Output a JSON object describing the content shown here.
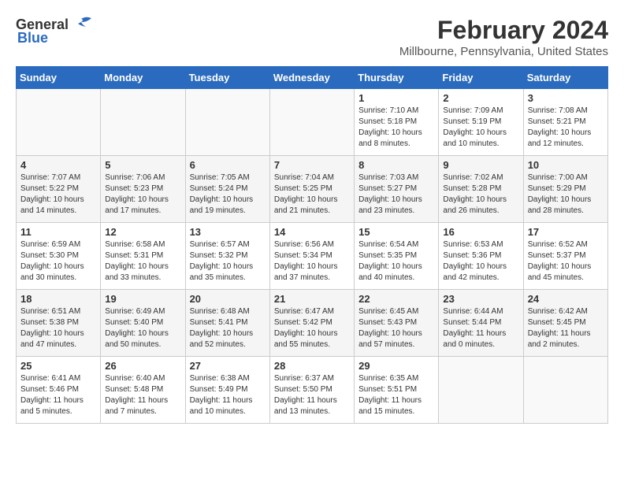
{
  "logo": {
    "general": "General",
    "blue": "Blue"
  },
  "title": "February 2024",
  "subtitle": "Millbourne, Pennsylvania, United States",
  "days_of_week": [
    "Sunday",
    "Monday",
    "Tuesday",
    "Wednesday",
    "Thursday",
    "Friday",
    "Saturday"
  ],
  "weeks": [
    [
      {
        "day": "",
        "info": ""
      },
      {
        "day": "",
        "info": ""
      },
      {
        "day": "",
        "info": ""
      },
      {
        "day": "",
        "info": ""
      },
      {
        "day": "1",
        "info": "Sunrise: 7:10 AM\nSunset: 5:18 PM\nDaylight: 10 hours\nand 8 minutes."
      },
      {
        "day": "2",
        "info": "Sunrise: 7:09 AM\nSunset: 5:19 PM\nDaylight: 10 hours\nand 10 minutes."
      },
      {
        "day": "3",
        "info": "Sunrise: 7:08 AM\nSunset: 5:21 PM\nDaylight: 10 hours\nand 12 minutes."
      }
    ],
    [
      {
        "day": "4",
        "info": "Sunrise: 7:07 AM\nSunset: 5:22 PM\nDaylight: 10 hours\nand 14 minutes."
      },
      {
        "day": "5",
        "info": "Sunrise: 7:06 AM\nSunset: 5:23 PM\nDaylight: 10 hours\nand 17 minutes."
      },
      {
        "day": "6",
        "info": "Sunrise: 7:05 AM\nSunset: 5:24 PM\nDaylight: 10 hours\nand 19 minutes."
      },
      {
        "day": "7",
        "info": "Sunrise: 7:04 AM\nSunset: 5:25 PM\nDaylight: 10 hours\nand 21 minutes."
      },
      {
        "day": "8",
        "info": "Sunrise: 7:03 AM\nSunset: 5:27 PM\nDaylight: 10 hours\nand 23 minutes."
      },
      {
        "day": "9",
        "info": "Sunrise: 7:02 AM\nSunset: 5:28 PM\nDaylight: 10 hours\nand 26 minutes."
      },
      {
        "day": "10",
        "info": "Sunrise: 7:00 AM\nSunset: 5:29 PM\nDaylight: 10 hours\nand 28 minutes."
      }
    ],
    [
      {
        "day": "11",
        "info": "Sunrise: 6:59 AM\nSunset: 5:30 PM\nDaylight: 10 hours\nand 30 minutes."
      },
      {
        "day": "12",
        "info": "Sunrise: 6:58 AM\nSunset: 5:31 PM\nDaylight: 10 hours\nand 33 minutes."
      },
      {
        "day": "13",
        "info": "Sunrise: 6:57 AM\nSunset: 5:32 PM\nDaylight: 10 hours\nand 35 minutes."
      },
      {
        "day": "14",
        "info": "Sunrise: 6:56 AM\nSunset: 5:34 PM\nDaylight: 10 hours\nand 37 minutes."
      },
      {
        "day": "15",
        "info": "Sunrise: 6:54 AM\nSunset: 5:35 PM\nDaylight: 10 hours\nand 40 minutes."
      },
      {
        "day": "16",
        "info": "Sunrise: 6:53 AM\nSunset: 5:36 PM\nDaylight: 10 hours\nand 42 minutes."
      },
      {
        "day": "17",
        "info": "Sunrise: 6:52 AM\nSunset: 5:37 PM\nDaylight: 10 hours\nand 45 minutes."
      }
    ],
    [
      {
        "day": "18",
        "info": "Sunrise: 6:51 AM\nSunset: 5:38 PM\nDaylight: 10 hours\nand 47 minutes."
      },
      {
        "day": "19",
        "info": "Sunrise: 6:49 AM\nSunset: 5:40 PM\nDaylight: 10 hours\nand 50 minutes."
      },
      {
        "day": "20",
        "info": "Sunrise: 6:48 AM\nSunset: 5:41 PM\nDaylight: 10 hours\nand 52 minutes."
      },
      {
        "day": "21",
        "info": "Sunrise: 6:47 AM\nSunset: 5:42 PM\nDaylight: 10 hours\nand 55 minutes."
      },
      {
        "day": "22",
        "info": "Sunrise: 6:45 AM\nSunset: 5:43 PM\nDaylight: 10 hours\nand 57 minutes."
      },
      {
        "day": "23",
        "info": "Sunrise: 6:44 AM\nSunset: 5:44 PM\nDaylight: 11 hours\nand 0 minutes."
      },
      {
        "day": "24",
        "info": "Sunrise: 6:42 AM\nSunset: 5:45 PM\nDaylight: 11 hours\nand 2 minutes."
      }
    ],
    [
      {
        "day": "25",
        "info": "Sunrise: 6:41 AM\nSunset: 5:46 PM\nDaylight: 11 hours\nand 5 minutes."
      },
      {
        "day": "26",
        "info": "Sunrise: 6:40 AM\nSunset: 5:48 PM\nDaylight: 11 hours\nand 7 minutes."
      },
      {
        "day": "27",
        "info": "Sunrise: 6:38 AM\nSunset: 5:49 PM\nDaylight: 11 hours\nand 10 minutes."
      },
      {
        "day": "28",
        "info": "Sunrise: 6:37 AM\nSunset: 5:50 PM\nDaylight: 11 hours\nand 13 minutes."
      },
      {
        "day": "29",
        "info": "Sunrise: 6:35 AM\nSunset: 5:51 PM\nDaylight: 11 hours\nand 15 minutes."
      },
      {
        "day": "",
        "info": ""
      },
      {
        "day": "",
        "info": ""
      }
    ]
  ]
}
